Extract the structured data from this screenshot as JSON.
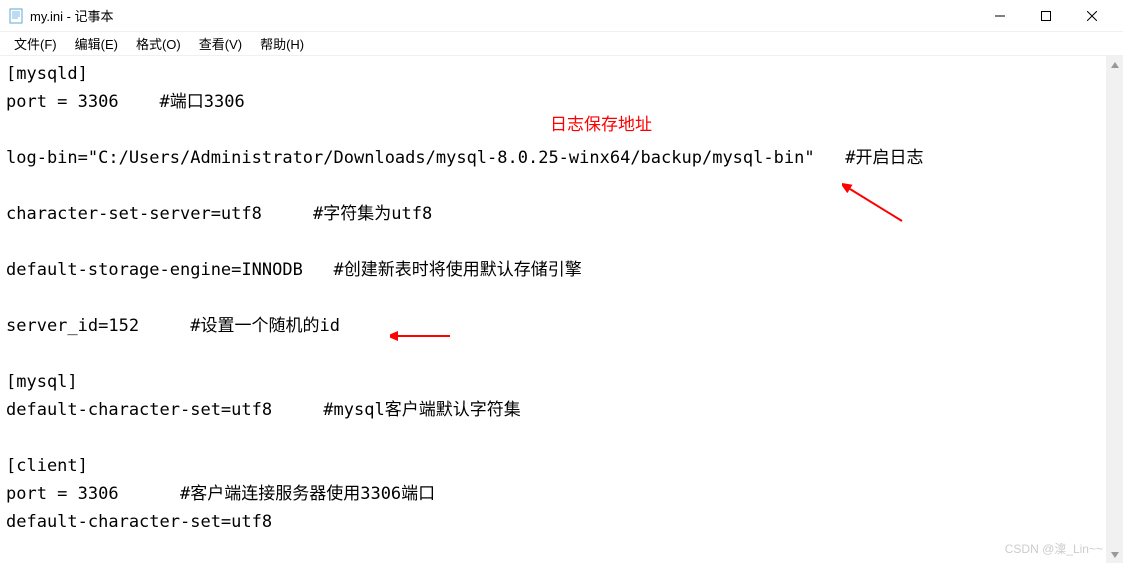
{
  "window": {
    "title": "my.ini - 记事本"
  },
  "menu": {
    "file": "文件(F)",
    "edit": "编辑(E)",
    "format": "格式(O)",
    "view": "查看(V)",
    "help": "帮助(H)"
  },
  "content": {
    "line1": "[mysqld]",
    "line2": "port = 3306    #端口3306",
    "line3": "log-bin=\"C:/Users/Administrator/Downloads/mysql-8.0.25-winx64/backup/mysql-bin\"   #开启日志",
    "line4": "character-set-server=utf8     #字符集为utf8",
    "line5": "default-storage-engine=INNODB   #创建新表时将使用默认存储引擎",
    "line6": "server_id=152     #设置一个随机的id",
    "line7": "[mysql]",
    "line8": "default-character-set=utf8     #mysql客户端默认字符集",
    "line9": "[client]",
    "line10": "port = 3306      #客户端连接服务器使用3306端口",
    "line11": "default-character-set=utf8"
  },
  "annotations": {
    "label1": "日志保存地址"
  },
  "watermark": "CSDN @澟_Lin~~"
}
